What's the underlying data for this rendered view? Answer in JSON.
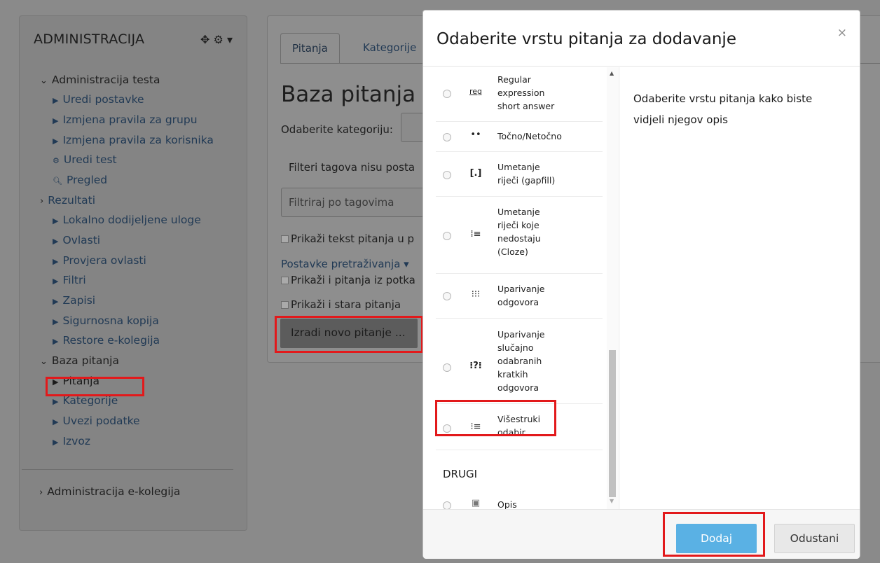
{
  "admin": {
    "title": "ADMINISTRACIJA",
    "controls": "✥ ⚙ ▾",
    "items": [
      {
        "label": "Administracija testa",
        "kind": "open"
      },
      {
        "label": "Uredi postavke",
        "kind": "link"
      },
      {
        "label": "Izmjena pravila za grupu",
        "kind": "link"
      },
      {
        "label": "Izmjena pravila za korisnika",
        "kind": "link"
      },
      {
        "label": "Uredi test",
        "kind": "link-gear"
      },
      {
        "label": "Pregled",
        "kind": "link-zoom"
      },
      {
        "label": "Rezultati",
        "kind": "closed"
      },
      {
        "label": "Lokalno dodijeljene uloge",
        "kind": "link"
      },
      {
        "label": "Ovlasti",
        "kind": "link"
      },
      {
        "label": "Provjera ovlasti",
        "kind": "link"
      },
      {
        "label": "Filtri",
        "kind": "link"
      },
      {
        "label": "Zapisi",
        "kind": "link"
      },
      {
        "label": "Sigurnosna kopija",
        "kind": "link"
      },
      {
        "label": "Restore e-kolegija",
        "kind": "link"
      },
      {
        "label": "Baza pitanja",
        "kind": "open"
      },
      {
        "label": "Pitanja",
        "kind": "link-active"
      },
      {
        "label": "Kategorije",
        "kind": "link"
      },
      {
        "label": "Uvezi podatke",
        "kind": "link"
      },
      {
        "label": "Izvoz",
        "kind": "link"
      }
    ],
    "footer_item": "Administracija e-kolegija"
  },
  "main": {
    "tabs": [
      "Pitanja",
      "Kategorije"
    ],
    "title": "Baza pitanja",
    "category_label": "Odaberite kategoriju:",
    "tags_info": "Filteri tagova nisu posta",
    "tag_filter_placeholder": "Filtriraj po tagovima",
    "show_text_option": "Prikaži tekst pitanja u p",
    "search_options": "Postavke pretraživanja ▾",
    "show_sub_option": "Prikaži i pitanja iz potka",
    "show_old_option": "Prikaži i stara pitanja",
    "create_button": "Izradi novo pitanje ..."
  },
  "modal": {
    "title": "Odaberite vrstu pitanja za dodavanje",
    "close": "×",
    "question_types": [
      {
        "lines": [
          "Regular",
          "expression",
          "short answer"
        ],
        "icon": "reg"
      },
      {
        "lines": [
          "Točno/Netočno"
        ],
        "icon": "••"
      },
      {
        "lines": [
          "Umetanje",
          "riječi (gapfill)"
        ],
        "icon": "[.]"
      },
      {
        "lines": [
          "Umetanje",
          "riječi koje",
          "nedostaju",
          "(Cloze)"
        ],
        "icon": "⁞≡"
      },
      {
        "lines": [
          "Uparivanje",
          "odgovora"
        ],
        "icon": "⁝⁝⁝"
      },
      {
        "lines": [
          "Uparivanje",
          "slučajno",
          "odabranih",
          "kratkih",
          "odgovora"
        ],
        "icon": "⁝?⁝"
      },
      {
        "lines": [
          "Višestruki",
          "odabir"
        ],
        "icon": "⁝≡"
      }
    ],
    "other_group": "DRUGI",
    "other_types": [
      {
        "lines": [
          "Opis"
        ],
        "icon": "▣"
      }
    ],
    "description": "Odaberite vrstu pitanja kako biste vidjeli njegov opis",
    "add_button": "Dodaj",
    "cancel_button": "Odustani"
  }
}
